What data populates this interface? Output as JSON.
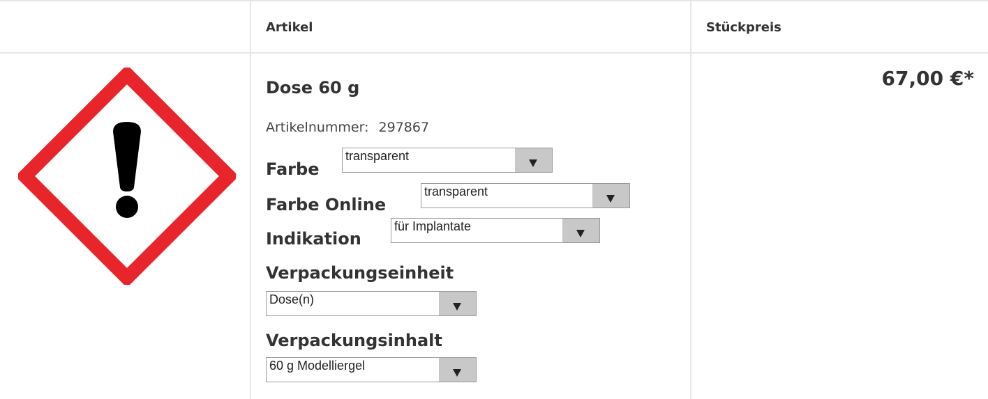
{
  "table": {
    "header_article": "Artikel",
    "header_unit_price": "Stückpreis"
  },
  "product": {
    "image_icon": "hazard-exclamation-icon",
    "name": "Dose 60 g",
    "article_number_label": "Artikelnummer:",
    "article_number": "297867",
    "price": "67,00 €*"
  },
  "options": {
    "farbe": {
      "label": "Farbe",
      "value": "transparent"
    },
    "farbe_online": {
      "label": "Farbe Online",
      "value": "transparent"
    },
    "indikation": {
      "label": "Indikation",
      "value": "für Implantate"
    },
    "verpackungseinheit": {
      "label": "Verpackungseinheit",
      "value": "Dose(n)"
    },
    "verpackungsinhalt": {
      "label": "Verpackungsinhalt",
      "value": "60 g Modelliergel"
    }
  },
  "colors": {
    "hazard_red": "#e8252b",
    "dropdown_button": "#c8c8c8"
  }
}
